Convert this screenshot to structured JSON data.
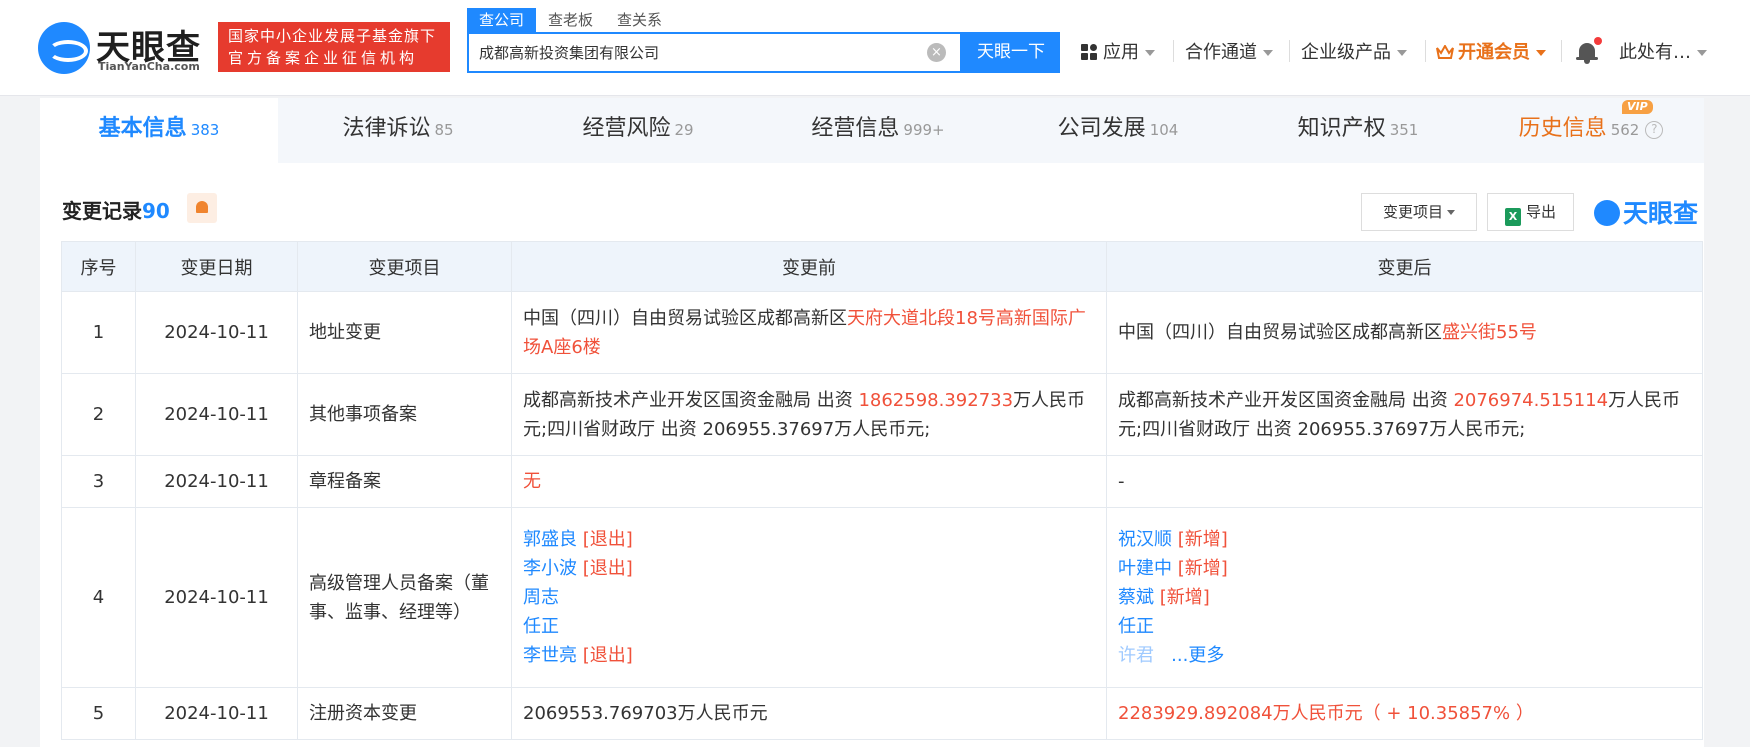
{
  "brand": {
    "name": "天眼查",
    "domain": "TianYanCha.com",
    "badge_line1": "国家中小企业发展子基金旗下",
    "badge_line2": "官方备案企业征信机构"
  },
  "search": {
    "tabs": [
      "查公司",
      "查老板",
      "查关系"
    ],
    "value": "成都高新投资集团有限公司",
    "clear_glyph": "×",
    "button_label": "天眼一下"
  },
  "nav": {
    "apps": "应用",
    "cooperation": "合作通道",
    "enterprise": "企业级产品",
    "vip": "开通会员",
    "user": "此处有…"
  },
  "tabs": [
    {
      "label": "基本信息",
      "count": "383"
    },
    {
      "label": "法律诉讼",
      "count": "85"
    },
    {
      "label": "经营风险",
      "count": "29"
    },
    {
      "label": "经营信息",
      "count": "999+"
    },
    {
      "label": "公司发展",
      "count": "104"
    },
    {
      "label": "知识产权",
      "count": "351"
    },
    {
      "label": "历史信息",
      "count": "562",
      "tag": "VIP",
      "help": "?"
    }
  ],
  "section": {
    "title": "变更记录",
    "count": "90",
    "filter_label": "变更项目",
    "export_label": "导出",
    "export_icon": "X",
    "watermark": "天眼查"
  },
  "table": {
    "headers": [
      "序号",
      "变更日期",
      "变更项目",
      "变更前",
      "变更后"
    ],
    "rows": [
      {
        "no": "1",
        "date": "2024-10-11",
        "item": "地址变更",
        "before_plain": "中国（四川）自由贸易试验区成都高新区",
        "before_hl": "天府大道北段18号高新国际广场A座6楼",
        "after_plain": "中国（四川）自由贸易试验区成都高新区",
        "after_hl": "盛兴街55号"
      },
      {
        "no": "2",
        "date": "2024-10-11",
        "item": "其他事项备案",
        "before_a": "成都高新技术产业开发区国资金融局 出资 ",
        "before_amt": "1862598.392733",
        "before_b": "万人民币元;四川省财政厅 出资 206955.37697万人民币元;",
        "after_a": "成都高新技术产业开发区国资金融局 出资 ",
        "after_amt": "2076974.515114",
        "after_b": "万人民币元;四川省财政厅 出资 206955.37697万人民币元;"
      },
      {
        "no": "3",
        "date": "2024-10-11",
        "item": "章程备案",
        "before": "无",
        "after": "-"
      },
      {
        "no": "4",
        "date": "2024-10-11",
        "item": "高级管理人员备案（董事、监事、经理等）",
        "before_people": [
          {
            "name": "郭盛良",
            "tag": "[退出]"
          },
          {
            "name": "李小波",
            "tag": "[退出]"
          },
          {
            "name": "周志",
            "tag": ""
          },
          {
            "name": "任正",
            "tag": ""
          },
          {
            "name": "李世亮",
            "tag": "[退出]"
          }
        ],
        "after_people": [
          {
            "name": "祝汉顺",
            "tag": "[新增]"
          },
          {
            "name": "叶建中",
            "tag": "[新增]"
          },
          {
            "name": "蔡斌",
            "tag": "[新增]"
          },
          {
            "name": "任正",
            "tag": ""
          }
        ],
        "after_last": "许君",
        "more_label": "...更多"
      },
      {
        "no": "5",
        "date": "2024-10-11",
        "item": "注册资本变更",
        "before": "2069553.769703万人民币元",
        "after": "2283929.892084万人民币元（ + 10.35857% ）"
      }
    ]
  }
}
